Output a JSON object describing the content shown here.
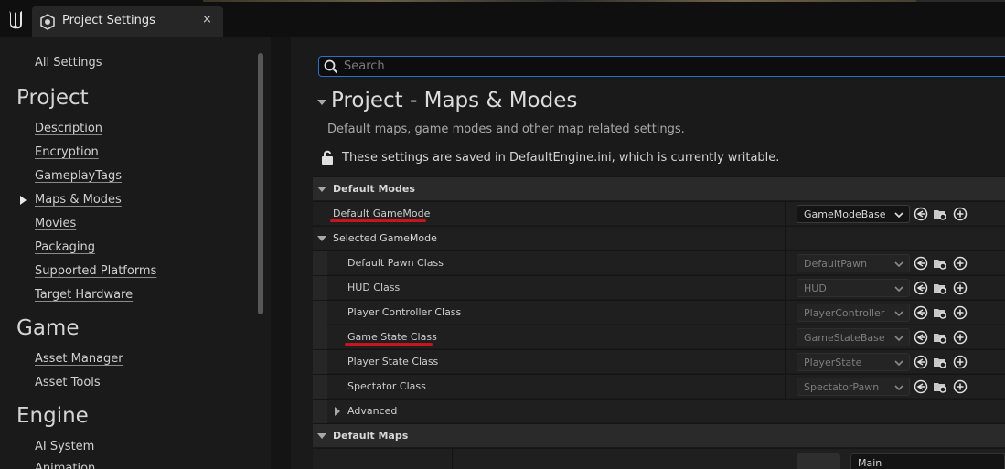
{
  "window": {
    "tab_title": "Project Settings",
    "tab_close": "×"
  },
  "sidebar": {
    "all_settings": "All Settings",
    "sections": [
      {
        "title": "Project",
        "items": [
          "Description",
          "Encryption",
          "GameplayTags",
          "Maps & Modes",
          "Movies",
          "Packaging",
          "Supported Platforms",
          "Target Hardware"
        ]
      },
      {
        "title": "Game",
        "items": [
          "Asset Manager",
          "Asset Tools"
        ]
      },
      {
        "title": "Engine",
        "items": [
          "AI System",
          "Animation"
        ]
      }
    ],
    "selected_item": "Maps & Modes"
  },
  "search": {
    "placeholder": "Search",
    "value": ""
  },
  "page": {
    "title": "Project - Maps & Modes",
    "description": "Default maps, game modes and other map related settings.",
    "saved_notice": "These settings are saved in DefaultEngine.ini, which is currently writable."
  },
  "grid": {
    "default_modes": {
      "category": "Default Modes",
      "default_gamemode_label": "Default GameMode",
      "default_gamemode_value": "GameModeBase"
    },
    "selected_gamemode": {
      "category": "Selected GameMode",
      "rows": [
        {
          "label": "Default Pawn Class",
          "value": "DefaultPawn"
        },
        {
          "label": "HUD Class",
          "value": "HUD"
        },
        {
          "label": "Player Controller Class",
          "value": "PlayerController"
        },
        {
          "label": "Game State Class",
          "value": "GameStateBase"
        },
        {
          "label": "Player State Class",
          "value": "PlayerState"
        },
        {
          "label": "Spectator Class",
          "value": "SpectatorPawn"
        }
      ],
      "advanced": "Advanced"
    },
    "default_maps": {
      "category": "Default Maps",
      "map_value": "Main"
    }
  },
  "colors": {
    "annotation_red": "#c4161c",
    "search_focus": "#2f6fbf"
  },
  "icons": {
    "browse": "use-selected-arrow-icon",
    "find": "browse-folder-icon",
    "add": "add-circle-icon"
  }
}
